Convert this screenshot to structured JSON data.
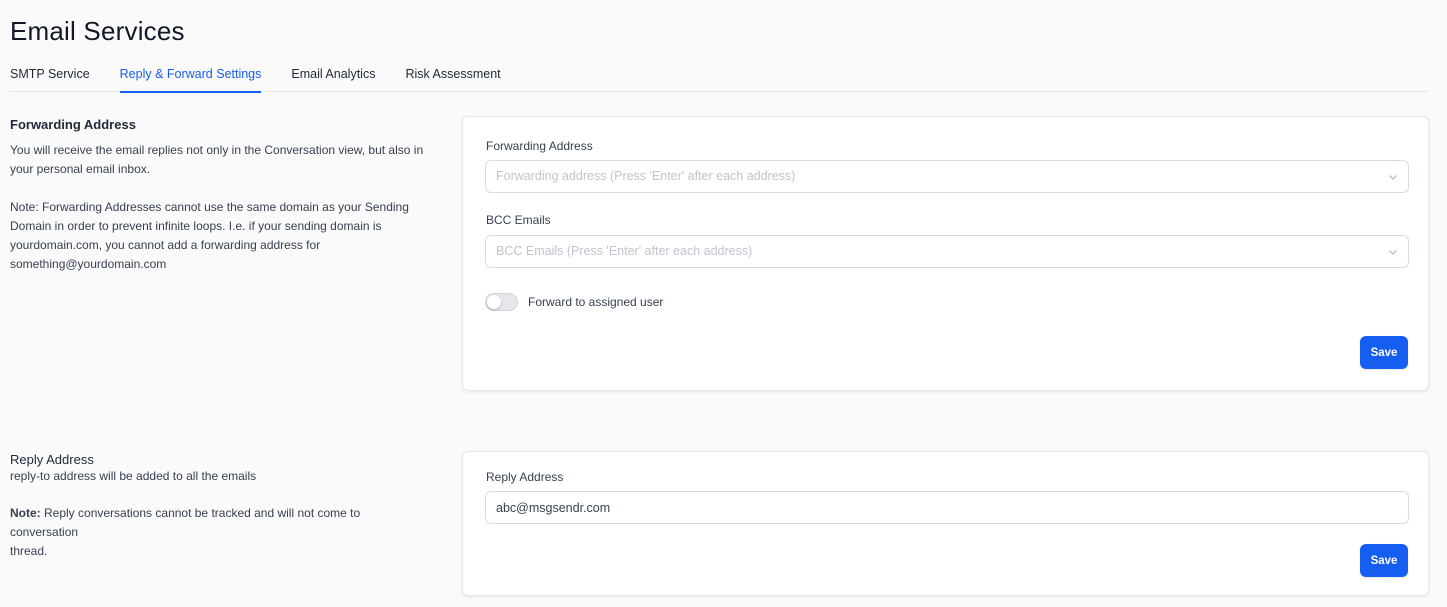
{
  "page": {
    "title": "Email Services"
  },
  "tabs": [
    {
      "label": "SMTP Service",
      "active": false
    },
    {
      "label": "Reply & Forward Settings",
      "active": true
    },
    {
      "label": "Email Analytics",
      "active": false
    },
    {
      "label": "Risk Assessment",
      "active": false
    }
  ],
  "forwarding": {
    "heading": "Forwarding Address",
    "description_line1": "You will receive the email replies not only in the Conversation view, but also in",
    "description_line2": "your personal email inbox.",
    "note_line1": "Note: Forwarding Addresses cannot use the same domain as your Sending",
    "note_line2": "Domain in order to prevent infinite loops. I.e. if your sending domain is",
    "note_line3": "yourdomain.com, you cannot add a forwarding address for",
    "note_line4": "something@yourdomain.com",
    "card": {
      "forwarding_label": "Forwarding Address",
      "forwarding_placeholder": "Forwarding address (Press 'Enter' after each address)",
      "bcc_label": "BCC Emails",
      "bcc_placeholder": "BCC Emails (Press 'Enter' after each address)",
      "toggle_label": "Forward to assigned user",
      "toggle_on": false,
      "save_label": "Save"
    }
  },
  "reply": {
    "heading": "Reply Address",
    "description": "reply-to address will be added to all the emails",
    "note_bold": "Note:",
    "note_line1": " Reply conversations cannot be tracked and will not come to conversation",
    "note_line2": "thread.",
    "card": {
      "label": "Reply Address",
      "value": "abc@msgsendr.com",
      "save_label": "Save"
    }
  },
  "colors": {
    "accent": "#155eef",
    "text": "#1f2937",
    "muted": "#c0c4cc"
  }
}
